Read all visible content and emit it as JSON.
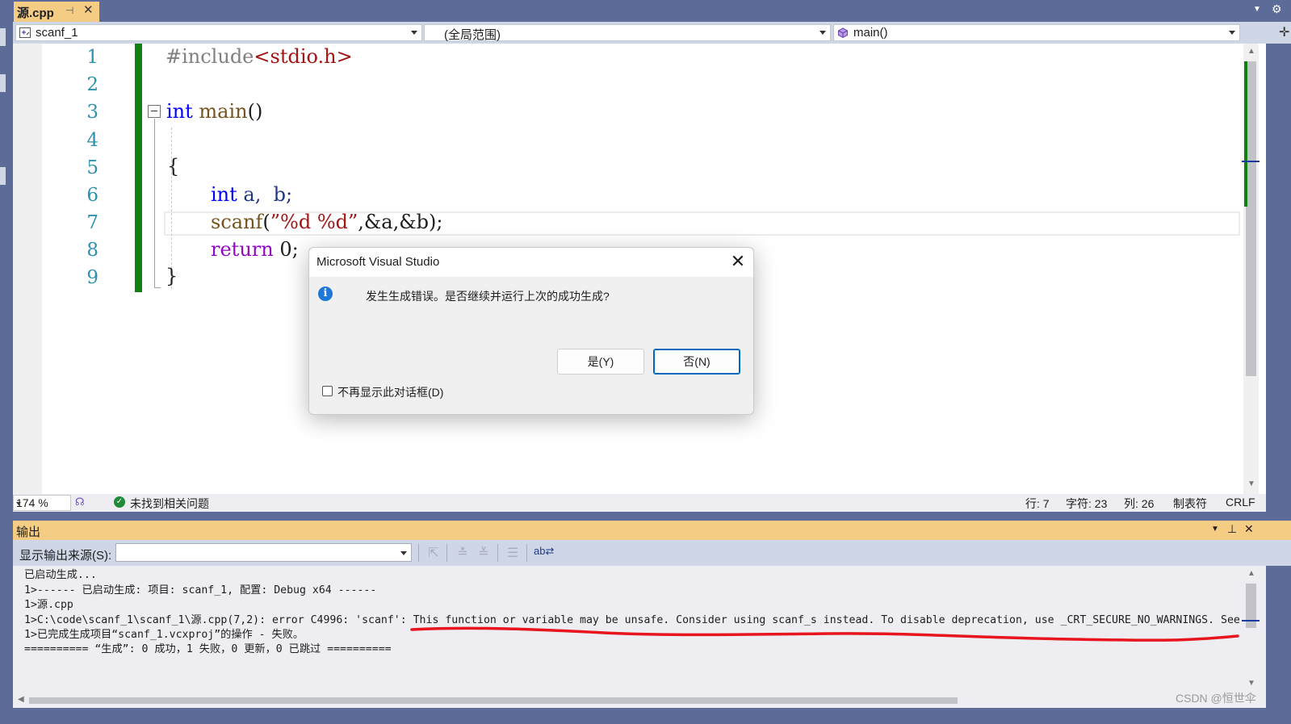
{
  "tab": {
    "title": "源.cpp",
    "pin": "⊣",
    "close": "✕"
  },
  "nav": {
    "project": "scanf_1",
    "scope": "(全局范围)",
    "member": "main()"
  },
  "editor": {
    "line_numbers": [
      "1",
      "2",
      "3",
      "4",
      "5",
      "6",
      "7",
      "8",
      "9"
    ],
    "include_directive": "#include",
    "include_header": "<stdio.h>",
    "kw_int": "int",
    "main_name": "main",
    "main_parens": "()",
    "open_brace": "{",
    "decl_vars": " a,  b;",
    "scanf_fn": "scanf",
    "scanf_open": "(",
    "scanf_fmt": "”%d %d”",
    "scanf_args": ",&a,&b);",
    "kw_return": "return",
    "return_val": " 0;",
    "close_brace": "}"
  },
  "status": {
    "zoom": "174 %",
    "issues": "未找到相关问题",
    "line": "行: 7",
    "char": "字符: 23",
    "col": "列: 26",
    "tabs": "制表符",
    "eol": "CRLF"
  },
  "output": {
    "title": "输出",
    "source_label": "显示输出来源(S):",
    "source_value": "",
    "lines": [
      "已启动生成...",
      "1>------ 已启动生成: 项目: scanf_1, 配置: Debug x64 ------",
      "1>源.cpp",
      "1>C:\\code\\scanf_1\\scanf_1\\源.cpp(7,2): error C4996: 'scanf': This function or variable may be unsafe. Consider using scanf_s instead. To disable deprecation, use _CRT_SECURE_NO_WARNINGS. See o",
      "1>已完成生成项目“scanf_1.vcxproj”的操作 - 失败。",
      "========== “生成”: 0 成功，1 失败，0 更新，0 已跳过 =========="
    ]
  },
  "dialog": {
    "title": "Microsoft Visual Studio",
    "message": "发生生成错误。是否继续并运行上次的成功生成?",
    "yes": "是(Y)",
    "no": "否(N)",
    "dont_show": "不再显示此对话框(D)"
  },
  "watermark": "CSDN @恒世伞",
  "colors": {
    "frame": "#5d6b99",
    "tab_active": "#f5cc84",
    "change_bar": "#108010",
    "line_number": "#2b91af",
    "keyword": "#0000ff",
    "string": "#a31515",
    "annotation_red": "#e8141e"
  }
}
